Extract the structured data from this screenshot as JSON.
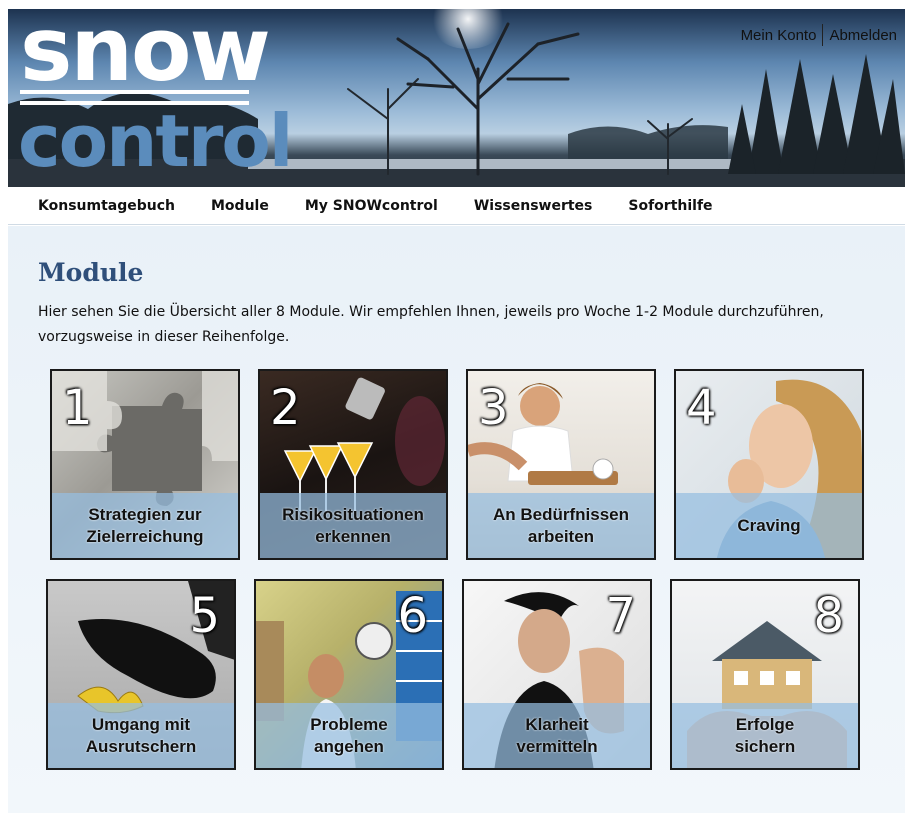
{
  "header": {
    "logo_top": "snow",
    "logo_bottom": "control",
    "account_link": "Mein Konto",
    "logout_link": "Abmelden"
  },
  "nav": {
    "items": [
      "Konsumtagebuch",
      "Module",
      "My SNOWcontrol",
      "Wissenswertes",
      "Soforthilfe"
    ]
  },
  "main": {
    "title": "Module",
    "intro": "Hier sehen Sie die Übersicht aller 8 Module. Wir empfehlen Ihnen, jeweils pro Woche 1-2 Module durchzuführen, vorzugsweise in dieser Reihenfolge.",
    "modules": [
      {
        "number": "1",
        "label": "Strategien zur\nZielerreichung",
        "image": "puzzle-image"
      },
      {
        "number": "2",
        "label": "Risikosituationen\nerkennen",
        "image": "cocktails-image"
      },
      {
        "number": "3",
        "label": "An Bedürfnissen\narbeiten",
        "image": "breakfast-image"
      },
      {
        "number": "4",
        "label": "Craving",
        "image": "woman-biting-nails-image"
      },
      {
        "number": "5",
        "label": "Umgang mit\nAusrutschern",
        "image": "banana-peel-image"
      },
      {
        "number": "6",
        "label": "Probleme\nangehen",
        "image": "stressed-office-image"
      },
      {
        "number": "7",
        "label": "Klarheit\nvermitteln",
        "image": "stop-hand-image"
      },
      {
        "number": "8",
        "label": "Erfolge\nsichern",
        "image": "house-in-hands-image"
      }
    ]
  },
  "colors": {
    "logo_blue": "#5b8cbc",
    "title_blue": "#2f4f7a",
    "label_band": "#96bee1"
  }
}
